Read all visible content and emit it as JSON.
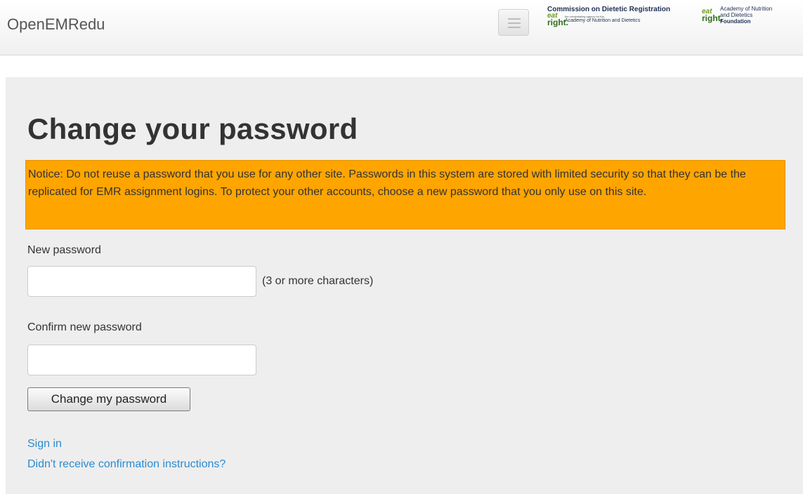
{
  "navbar": {
    "brand": "OpenEMRedu",
    "logos": {
      "cdr": {
        "title": "Commission on Dietetic Registration",
        "tagline": "the credentialing agency for the",
        "subtitle": "Academy of Nutrition and Dietetics",
        "mark_top": "eat",
        "mark_bottom": "right."
      },
      "foundation": {
        "line1": "Academy of Nutrition",
        "line2": "and Dietetics",
        "line3": "Foundation",
        "mark_top": "eat",
        "mark_bottom": "right."
      }
    }
  },
  "page": {
    "title": "Change your password",
    "notice": "Notice: Do not reuse a password that you use for any other site. Passwords in this system are stored with limited security so that they can be the replicated for EMR assignment logins. To protect your other accounts, choose a new password that you only use on this site.",
    "notice_color": "#ffa500",
    "new_password": {
      "label": "New password",
      "value": "",
      "hint": "(3 or more characters)"
    },
    "confirm_password": {
      "label": "Confirm new password",
      "value": ""
    },
    "submit_label": "Change my password",
    "links": {
      "sign_in": "Sign in",
      "confirmation": "Didn't receive confirmation instructions?"
    },
    "link_color": "#2a8bd0"
  }
}
